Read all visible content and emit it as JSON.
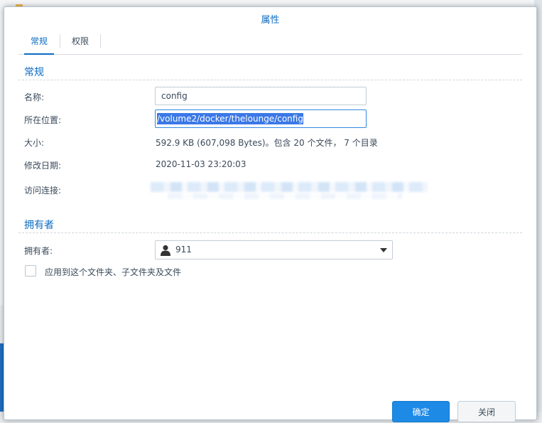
{
  "dialog": {
    "title": "属性",
    "tabs": [
      {
        "label": "常规",
        "active": true
      },
      {
        "label": "权限",
        "active": false
      }
    ],
    "general_section": {
      "title": "常规",
      "name_label": "名称:",
      "name_value": "config",
      "location_label": "所在位置:",
      "location_value": "/volume2/docker/thelounge/config",
      "size_label": "大小:",
      "size_value": "592.9 KB (607,098 Bytes)。包含 20 个文件， 7 个目录",
      "modified_label": "修改日期:",
      "modified_value": "2020-11-03 23:20:03",
      "link_label": "访问连接:"
    },
    "owner_section": {
      "title": "拥有者",
      "owner_label": "拥有者:",
      "owner_value": "911",
      "owner_icon": "user-icon",
      "apply_checkbox_label": "应用到这个文件夹、子文件夹及文件",
      "apply_checked": false
    },
    "buttons": {
      "ok": "确定",
      "close": "关闭"
    }
  },
  "colors": {
    "accent": "#0b6bc2",
    "primary_button": "#1d8ae6",
    "selection": "#3b78e7"
  }
}
